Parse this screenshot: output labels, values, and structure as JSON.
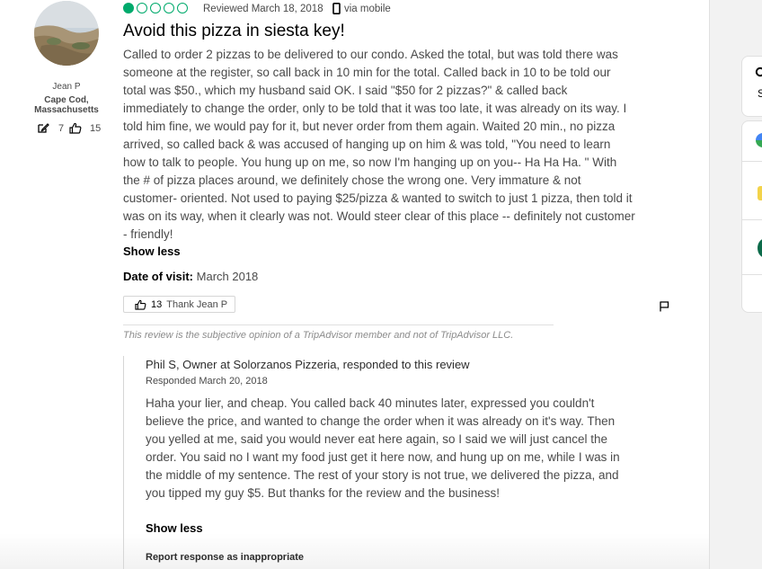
{
  "reviewer": {
    "name": "Jean P",
    "location": "Cape Cod, Massachusetts",
    "contributions": "7",
    "helpful_votes": "15"
  },
  "review": {
    "rating": 1,
    "rating_max": 5,
    "date": "Reviewed March 18, 2018",
    "source": "via mobile",
    "title": "Avoid this pizza in siesta key!",
    "body": "Called to order 2 pizzas to be delivered to our condo. Asked the total, but was told there was someone at the register, so call back in 10 min for the total. Called back in 10 to be told our total was $50., which my husband said OK. I said \"$50 for 2 pizzas?\" & called back immediately to change the order, only to be told that it was too late, it was already on its way. I told him fine, we would pay for it, but never order from them again. Waited 20 min., no pizza arrived, so called back & was accused of hanging up on him & was told, \"You need to learn how to talk to people. You hung up on me, so now I'm hanging up on you-- Ha Ha Ha. \" With the # of pizza places around, we definitely chose the wrong one. Very immature & not customer- oriented. Not used to paying $25/pizza & wanted to switch to just 1 pizza, then told it was on its way, when it clearly was not. Would steer clear of this place -- definitely not customer - friendly!",
    "show_less": "Show less",
    "visit_label": "Date of visit:",
    "visit_value": "March 2018",
    "thank_count": "13",
    "thank_label": "Thank Jean P",
    "disclaimer": "This review is the subjective opinion of a TripAdvisor member and not of TripAdvisor LLC."
  },
  "response": {
    "header": "Phil S, Owner at Solorzanos Pizzeria, responded to this review",
    "date": "Responded March 20, 2018",
    "body": "Haha your lier, and cheap. You called back 40 minutes later, expressed you couldn't believe the price, and wanted to change the order when it was already on it's way. Then you yelled at me, said you would never eat here again, so I said we will just cancel the order. You said no I want my food just get it here now, and hung up on me, while I was in the middle of my sentence. The rest of your story is not true, we delivered the pizza, and you tipped my guy $5. But thanks for the review and the business!",
    "show_less": "Show less",
    "report": "Report response as inappropriate"
  },
  "side_panel": {
    "letter": "S"
  },
  "colors": {
    "rating": "#00aa6c",
    "text": "#4a4a4a",
    "background": "#f2f2f2"
  }
}
